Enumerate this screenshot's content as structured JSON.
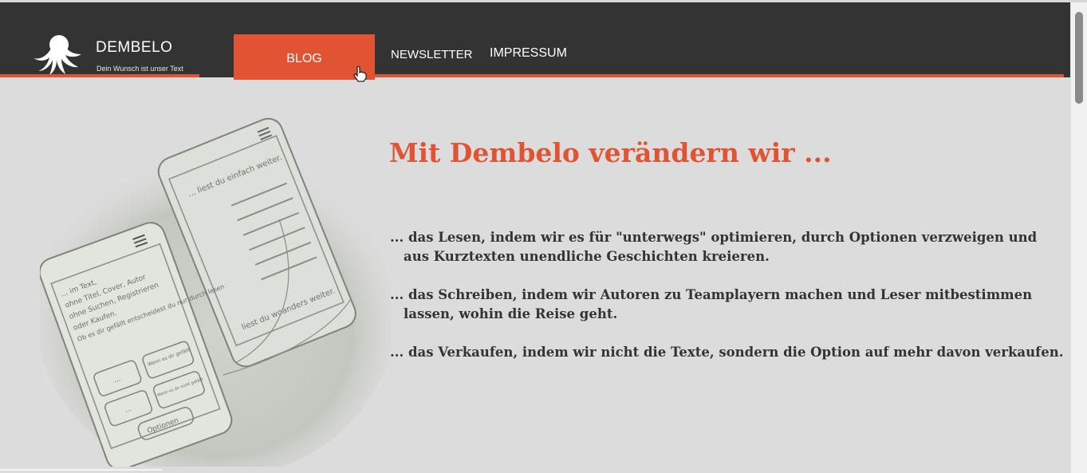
{
  "brand": {
    "name": "DEMBELO",
    "tagline": "Dein Wunsch ist unser Text",
    "logo_icon": "octopus-icon"
  },
  "nav": {
    "items": [
      {
        "label": "BLOG",
        "active": true
      },
      {
        "label": "NEWSLETTER",
        "active": false
      },
      {
        "label": "IMPRESSUM",
        "active": false
      }
    ]
  },
  "hero": {
    "headline": "Mit Dembelo verändern wir ...",
    "bullets": [
      "... das Lesen, indem wir es für \"unterwegs\" optimieren, durch Optionen verzweigen und aus Kurztexten unendliche Geschichten kreieren.",
      "... das Schreiben, indem wir Autoren zu Teamplayern machen und Leser mitbestimmen lassen, wohin die Reise geht.",
      "... das Verkaufen, indem wir nicht die Texte, sondern die Option auf mehr davon verkaufen."
    ],
    "sketch": {
      "phone_left_text": [
        "... im Text,",
        "ohne Titel, Cover, Autor",
        "ohne Suchen, Registrieren",
        "oder Kaufen.",
        "Ob es dir gefällt entscheidest du nur durch lesen"
      ],
      "phone_left_buttons": [
        "...",
        "Wenn es dir gefällt",
        "...",
        "Wenn es dir nicht gefällt",
        "Optionen"
      ],
      "phone_right_text": [
        "... liest du einfach weiter.",
        "liest du woanders weiter."
      ]
    }
  },
  "colors": {
    "accent": "#e05433",
    "navbar": "#333333",
    "background": "#dcdcdc",
    "text": "#333333"
  }
}
